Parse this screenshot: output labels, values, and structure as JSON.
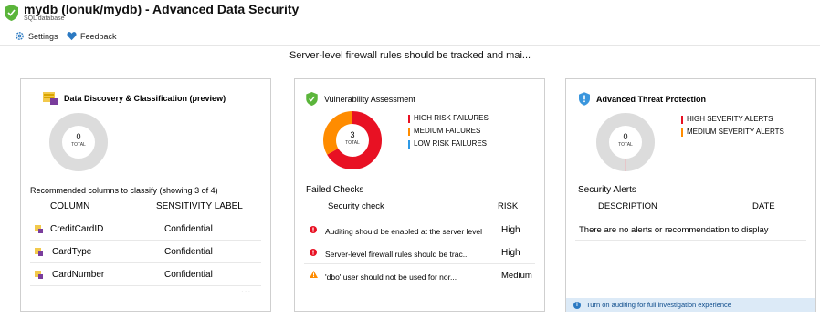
{
  "header": {
    "title": "mydb (lonuk/mydb) - Advanced Data Security",
    "subtitle": "SQL database",
    "shield_color": "#5bb53b"
  },
  "toolbar": {
    "settings_label": "Settings",
    "feedback_label": "Feedback"
  },
  "banner": "Server-level firewall rules should be tracked and mai...",
  "discovery": {
    "title": "Data Discovery & Classification (preview)",
    "total": "0",
    "total_label": "TOTAL",
    "section_title": "Recommended columns to classify (showing 3 of 4)",
    "col_header": "COLUMN",
    "label_header": "SENSITIVITY LABEL",
    "rows": [
      {
        "column": "CreditCardID",
        "label": "Confidential"
      },
      {
        "column": "CardType",
        "label": "Confidential"
      },
      {
        "column": "CardNumber",
        "label": "Confidential"
      }
    ],
    "more": "..."
  },
  "vulnerability": {
    "title": "Vulnerability Assessment",
    "total": "3",
    "total_label": "TOTAL",
    "legend": [
      {
        "label": "HIGH RISK FAILURES",
        "color": "#e81123"
      },
      {
        "label": "MEDIUM FAILURES",
        "color": "#ff8c00"
      },
      {
        "label": "LOW RISK FAILURES",
        "color": "#2e9ae6"
      }
    ],
    "chart_values": {
      "high": 2,
      "medium": 1,
      "low": 0
    },
    "section_title": "Failed Checks",
    "check_header": "Security check",
    "risk_header": "RISK",
    "checks": [
      {
        "text": "Auditing should be enabled at the server level",
        "risk": "High",
        "icon": "error-icon"
      },
      {
        "text": "Server-level firewall rules should be trac...",
        "risk": "High",
        "icon": "error-icon"
      },
      {
        "text": "'dbo' user should not be used for nor...",
        "risk": "Medium",
        "icon": "warning-icon"
      }
    ]
  },
  "threat": {
    "title": "Advanced Threat Protection",
    "total": "0",
    "total_label": "TOTAL",
    "legend": [
      {
        "label": "HIGH SEVERITY ALERTS",
        "color": "#e81123"
      },
      {
        "label": "MEDIUM SEVERITY ALERTS",
        "color": "#ff8c00"
      }
    ],
    "section_title": "Security Alerts",
    "desc_header": "DESCRIPTION",
    "date_header": "DATE",
    "empty_text": "There are no alerts or recommendation to display",
    "info": "Turn on auditing for full investigation experience"
  }
}
